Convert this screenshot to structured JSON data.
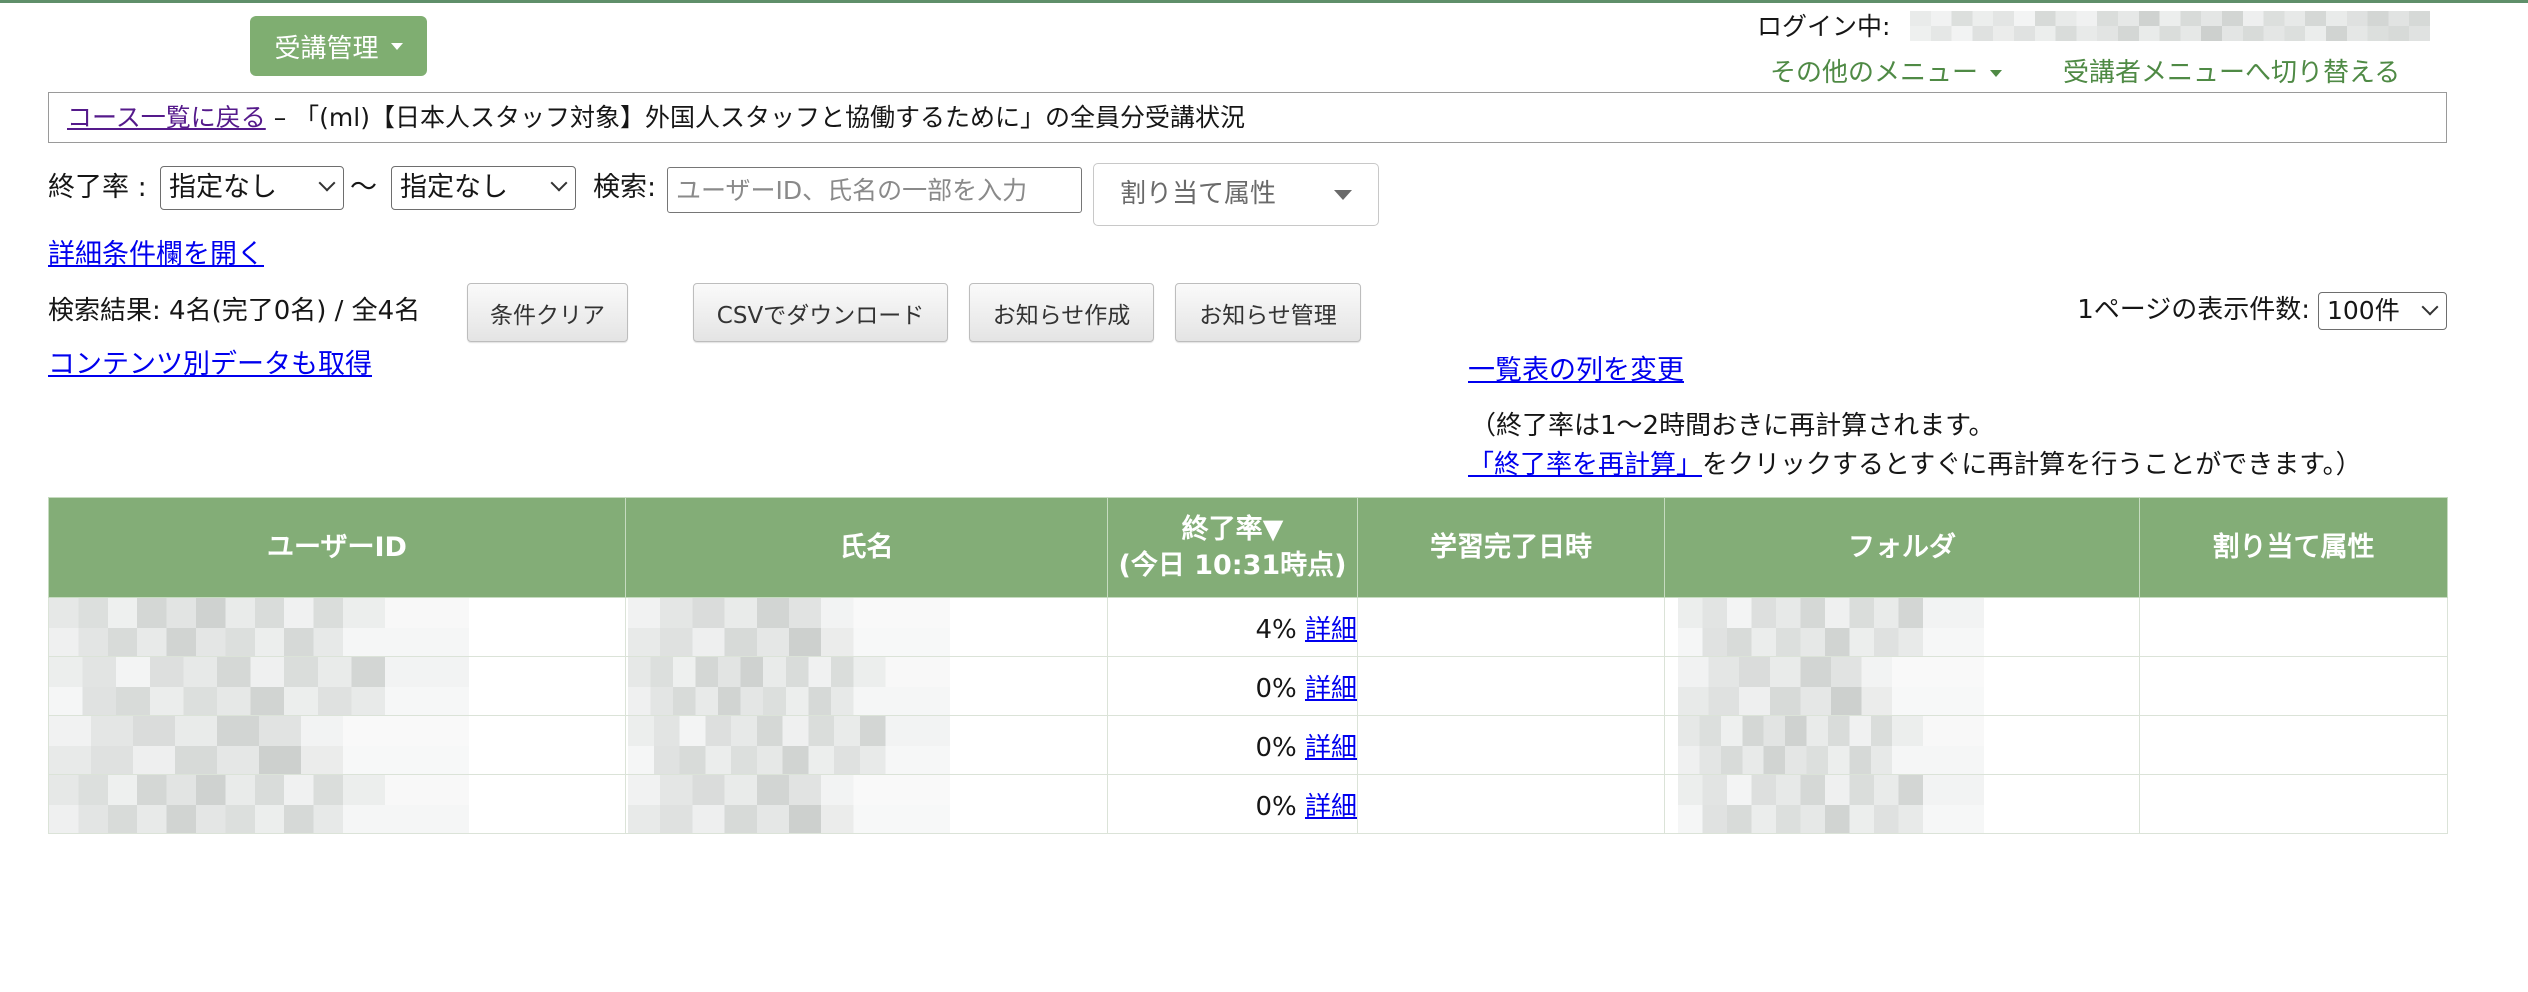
{
  "header": {
    "admin_menu_label": "受講管理",
    "login_label": "ログイン中:",
    "other_menu_label": "その他のメニュー",
    "switch_menu_label": "受講者メニューへ切り替える"
  },
  "breadcrumb": {
    "back_link": "コース一覧に戻る",
    "separator": " – ",
    "title": "「(ml)【日本人スタッフ対象】外国人スタッフと協働するために」の全員分受講状況"
  },
  "filters": {
    "completion_label": "終了率 :",
    "completion_from": "指定なし",
    "range_sep": "〜",
    "completion_to": "指定なし",
    "search_label": "検索:",
    "search_placeholder": "ユーザーID、氏名の一部を入力",
    "attribute_placeholder": "割り当て属性",
    "detail_toggle": "詳細条件欄を開く"
  },
  "results": {
    "summary": "検索結果: 4名(完了0名) / 全4名",
    "clear_button": "条件クリア",
    "csv_button": "CSVでダウンロード",
    "notice_create_button": "お知らせ作成",
    "notice_manage_button": "お知らせ管理",
    "per_page_label": "1ページの表示件数:",
    "per_page_value": "100件",
    "content_data_link": "コンテンツ別データも取得",
    "change_columns_link": "一覧表の列を変更",
    "recalc_note_1": "（終了率は1〜2時間おきに再計算されます。",
    "recalc_link": "「終了率を再計算」",
    "recalc_note_2": "をクリックするとすぐに再計算を行うことができます。）"
  },
  "table": {
    "headers": {
      "user_id": "ユーザーID",
      "name": "氏名",
      "completion": "終了率▼",
      "completion_sub": "(今日 10:31時点)",
      "completed_at": "学習完了日時",
      "folder": "フォルダ",
      "attribute": "割り当て属性"
    },
    "rows": [
      {
        "completion": "4%",
        "detail": "詳細"
      },
      {
        "completion": "0%",
        "detail": "詳細"
      },
      {
        "completion": "0%",
        "detail": "詳細"
      },
      {
        "completion": "0%",
        "detail": "詳細"
      }
    ]
  },
  "icons": [
    "caret-down-icon",
    "chevron-down-icon"
  ],
  "colors": {
    "brand_green": "#7fae71",
    "table_header_green": "#83ad77",
    "menu_text_green": "#4f8a45",
    "link_blue": "#0000ee",
    "visited_link_purple": "#551a8b"
  }
}
